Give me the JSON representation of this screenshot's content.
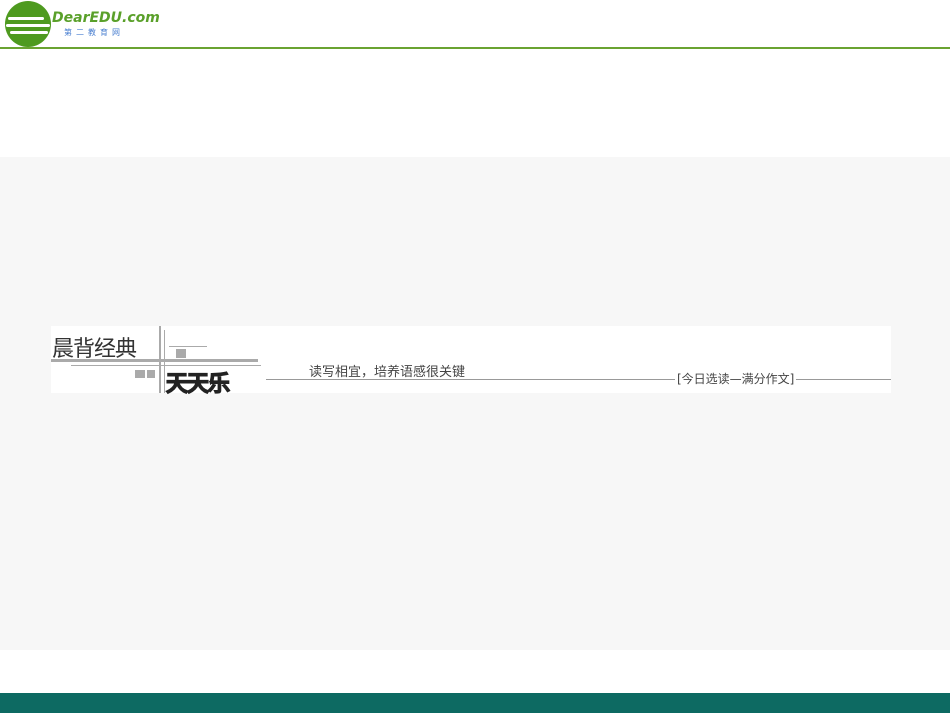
{
  "logo": {
    "name": "DearEDU.com",
    "subtitle": "第二教育网"
  },
  "banner": {
    "title": "晨背经典",
    "subtitle_art": "天天乐",
    "tagline": "读写相宜，培养语感很关键",
    "section": "[今日选读—满分作文]"
  },
  "colors": {
    "header_line": "#6aa331",
    "footer": "#0d6a62",
    "stage": "#f7f7f7"
  }
}
